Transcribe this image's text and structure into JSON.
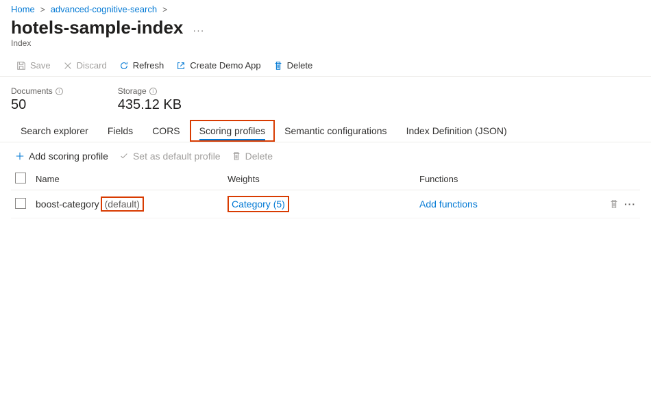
{
  "breadcrumb": {
    "home": "Home",
    "service": "advanced-cognitive-search"
  },
  "header": {
    "title": "hotels-sample-index",
    "subtitle": "Index"
  },
  "toolbar": {
    "save": "Save",
    "discard": "Discard",
    "refresh": "Refresh",
    "create_demo": "Create Demo App",
    "delete": "Delete"
  },
  "stats": {
    "documents_label": "Documents",
    "documents_value": "50",
    "storage_label": "Storage",
    "storage_value": "435.12 KB"
  },
  "tabs": {
    "search_explorer": "Search explorer",
    "fields": "Fields",
    "cors": "CORS",
    "scoring_profiles": "Scoring profiles",
    "semantic": "Semantic configurations",
    "index_def": "Index Definition (JSON)"
  },
  "sub_toolbar": {
    "add": "Add scoring profile",
    "set_default": "Set as default profile",
    "delete": "Delete"
  },
  "table": {
    "headers": {
      "name": "Name",
      "weights": "Weights",
      "functions": "Functions"
    },
    "rows": [
      {
        "name": "boost-category",
        "default_tag": "(default)",
        "weight": "Category (5)",
        "functions": "Add functions"
      }
    ]
  }
}
